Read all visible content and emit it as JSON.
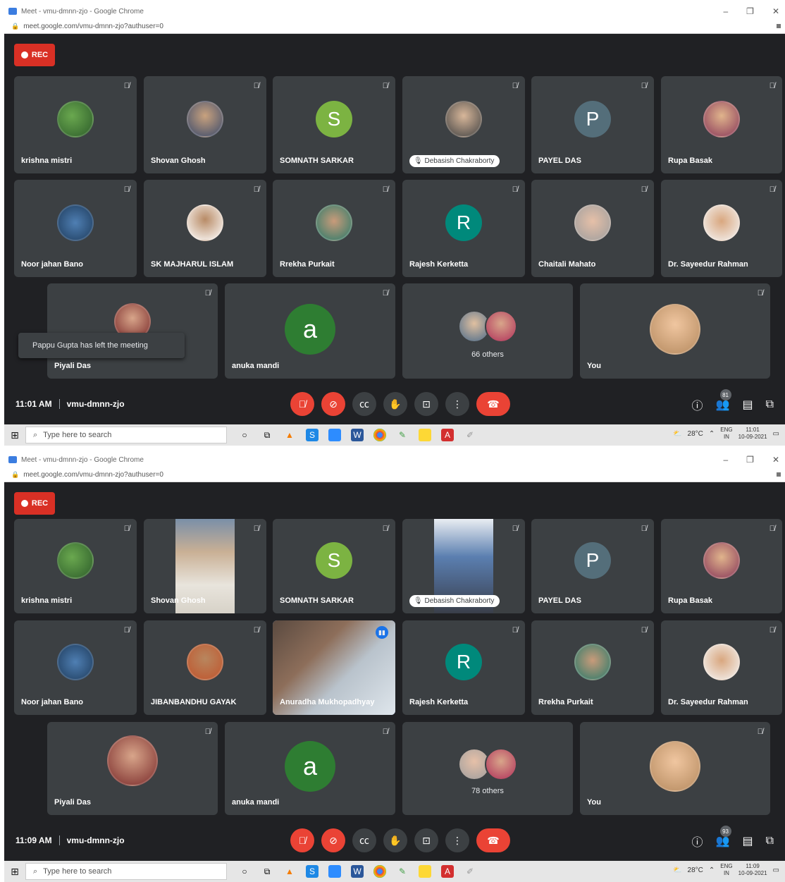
{
  "shots": [
    {
      "window_title": "Meet - vmu-dmnn-zjo - Google Chrome",
      "url": "meet.google.com/vmu-dmnn-zjo?authuser=0",
      "rec_label": "REC",
      "time": "11:01 AM",
      "meeting_code": "vmu-dmnn-zjo",
      "participant_count": "81",
      "tiles": [
        {
          "name": "krishna mistri"
        },
        {
          "name": "Shovan Ghosh"
        },
        {
          "name": "SOMNATH SARKAR",
          "letter": "S"
        },
        {
          "name": "Debasish Chakraborty"
        },
        {
          "name": "PAYEL DAS",
          "letter": "P"
        },
        {
          "name": "Rupa Basak"
        },
        {
          "name": "Noor jahan Bano"
        },
        {
          "name": "SK MAJHARUL ISLAM"
        },
        {
          "name": "Rrekha Purkait"
        },
        {
          "name": "Rajesh Kerketta",
          "letter": "R"
        },
        {
          "name": "Chaitali Mahato"
        },
        {
          "name": "Dr. Sayeedur Rahman"
        },
        {
          "name": "Piyali Das"
        },
        {
          "name": "anuka mandi",
          "letter": "a"
        },
        {
          "name": "66 others"
        },
        {
          "name": "You"
        }
      ],
      "toast": "Pappu Gupta has left the meeting",
      "taskbar": {
        "search": "Type here to search",
        "temp": "28°C",
        "lang": "ENG",
        "region": "IN",
        "clock": "11:01",
        "date": "10-09-2021"
      }
    },
    {
      "window_title": "Meet - vmu-dmnn-zjo - Google Chrome",
      "url": "meet.google.com/vmu-dmnn-zjo?authuser=0",
      "rec_label": "REC",
      "time": "11:09 AM",
      "meeting_code": "vmu-dmnn-zjo",
      "participant_count": "93",
      "tiles": [
        {
          "name": "krishna mistri"
        },
        {
          "name": "Shovan Ghosh"
        },
        {
          "name": "SOMNATH SARKAR",
          "letter": "S"
        },
        {
          "name": "Debasish Chakraborty"
        },
        {
          "name": "PAYEL DAS",
          "letter": "P"
        },
        {
          "name": "Rupa Basak"
        },
        {
          "name": "Noor jahan Bano"
        },
        {
          "name": "JIBANBANDHU GAYAK"
        },
        {
          "name": "Anuradha Mukhopadhyay"
        },
        {
          "name": "Rajesh Kerketta",
          "letter": "R"
        },
        {
          "name": "Rrekha Purkait"
        },
        {
          "name": "Dr. Sayeedur Rahman"
        },
        {
          "name": "Piyali Das"
        },
        {
          "name": "anuka mandi",
          "letter": "a"
        },
        {
          "name": "78 others"
        },
        {
          "name": "You"
        }
      ],
      "taskbar": {
        "search": "Type here to search",
        "temp": "28°C",
        "lang": "ENG",
        "region": "IN",
        "clock": "11:09",
        "date": "10-09-2021"
      }
    }
  ],
  "colors": {
    "meet_bg": "#202124",
    "tile_bg": "#3c4043",
    "rec_red": "#d93025",
    "end_call": "#ea4335",
    "avatar_s": "#7cb342",
    "avatar_p": "#546e7a",
    "avatar_r": "#00897b",
    "avatar_a": "#2e7d32"
  },
  "icons": [
    "mic-off-icon",
    "camera-off-icon",
    "captions-icon",
    "raise-hand-icon",
    "present-icon",
    "more-icon",
    "end-call-icon",
    "info-icon",
    "people-icon",
    "chat-icon",
    "activities-icon",
    "windows-start-icon",
    "search-icon"
  ]
}
